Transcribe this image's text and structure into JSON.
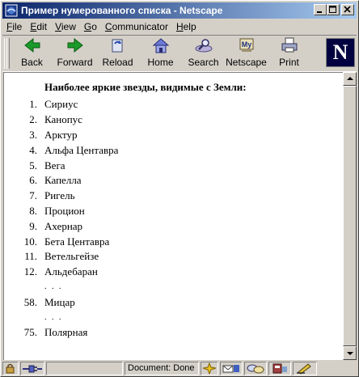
{
  "window": {
    "title": "Пример нумерованного списка - Netscape",
    "buttons": {
      "minimize": "_",
      "maximize": "□",
      "close": "×"
    }
  },
  "menu": [
    {
      "label": "File",
      "underline": "F",
      "rest": "ile"
    },
    {
      "label": "Edit",
      "underline": "E",
      "rest": "dit"
    },
    {
      "label": "View",
      "underline": "V",
      "rest": "iew"
    },
    {
      "label": "Go",
      "underline": "G",
      "rest": "o"
    },
    {
      "label": "Communicator",
      "underline": "C",
      "rest": "ommunicator"
    },
    {
      "label": "Help",
      "underline": "H",
      "rest": "elp"
    }
  ],
  "toolbar": {
    "back": "Back",
    "forward": "Forward",
    "reload": "Reload",
    "home": "Home",
    "search": "Search",
    "netscape": "Netscape",
    "print": "Print",
    "logo_letter": "N"
  },
  "page": {
    "heading": "Наиболее яркие звезды, видимые с Земли:",
    "items": [
      {
        "num": "1.",
        "name": "Сириус"
      },
      {
        "num": "2.",
        "name": "Канопус"
      },
      {
        "num": "3.",
        "name": "Арктур"
      },
      {
        "num": "4.",
        "name": "Альфа Центавра"
      },
      {
        "num": "5.",
        "name": "Вега"
      },
      {
        "num": "6.",
        "name": "Капелла"
      },
      {
        "num": "7.",
        "name": "Ригель"
      },
      {
        "num": "8.",
        "name": "Процион"
      },
      {
        "num": "9.",
        "name": "Ахернар"
      },
      {
        "num": "10.",
        "name": "Бета Центавра"
      },
      {
        "num": "11.",
        "name": "Ветельгейзе"
      },
      {
        "num": "12.",
        "name": "Альдебаран"
      },
      {
        "num": "",
        "name": ". . ."
      },
      {
        "num": "58.",
        "name": "Мицар"
      },
      {
        "num": "",
        "name": ". . ."
      },
      {
        "num": "75.",
        "name": "Полярная"
      }
    ]
  },
  "status": {
    "text": "Document: Done"
  },
  "colors": {
    "titlebar_start": "#0a246a",
    "titlebar_end": "#a6caf0",
    "chrome": "#d4d0c8"
  }
}
